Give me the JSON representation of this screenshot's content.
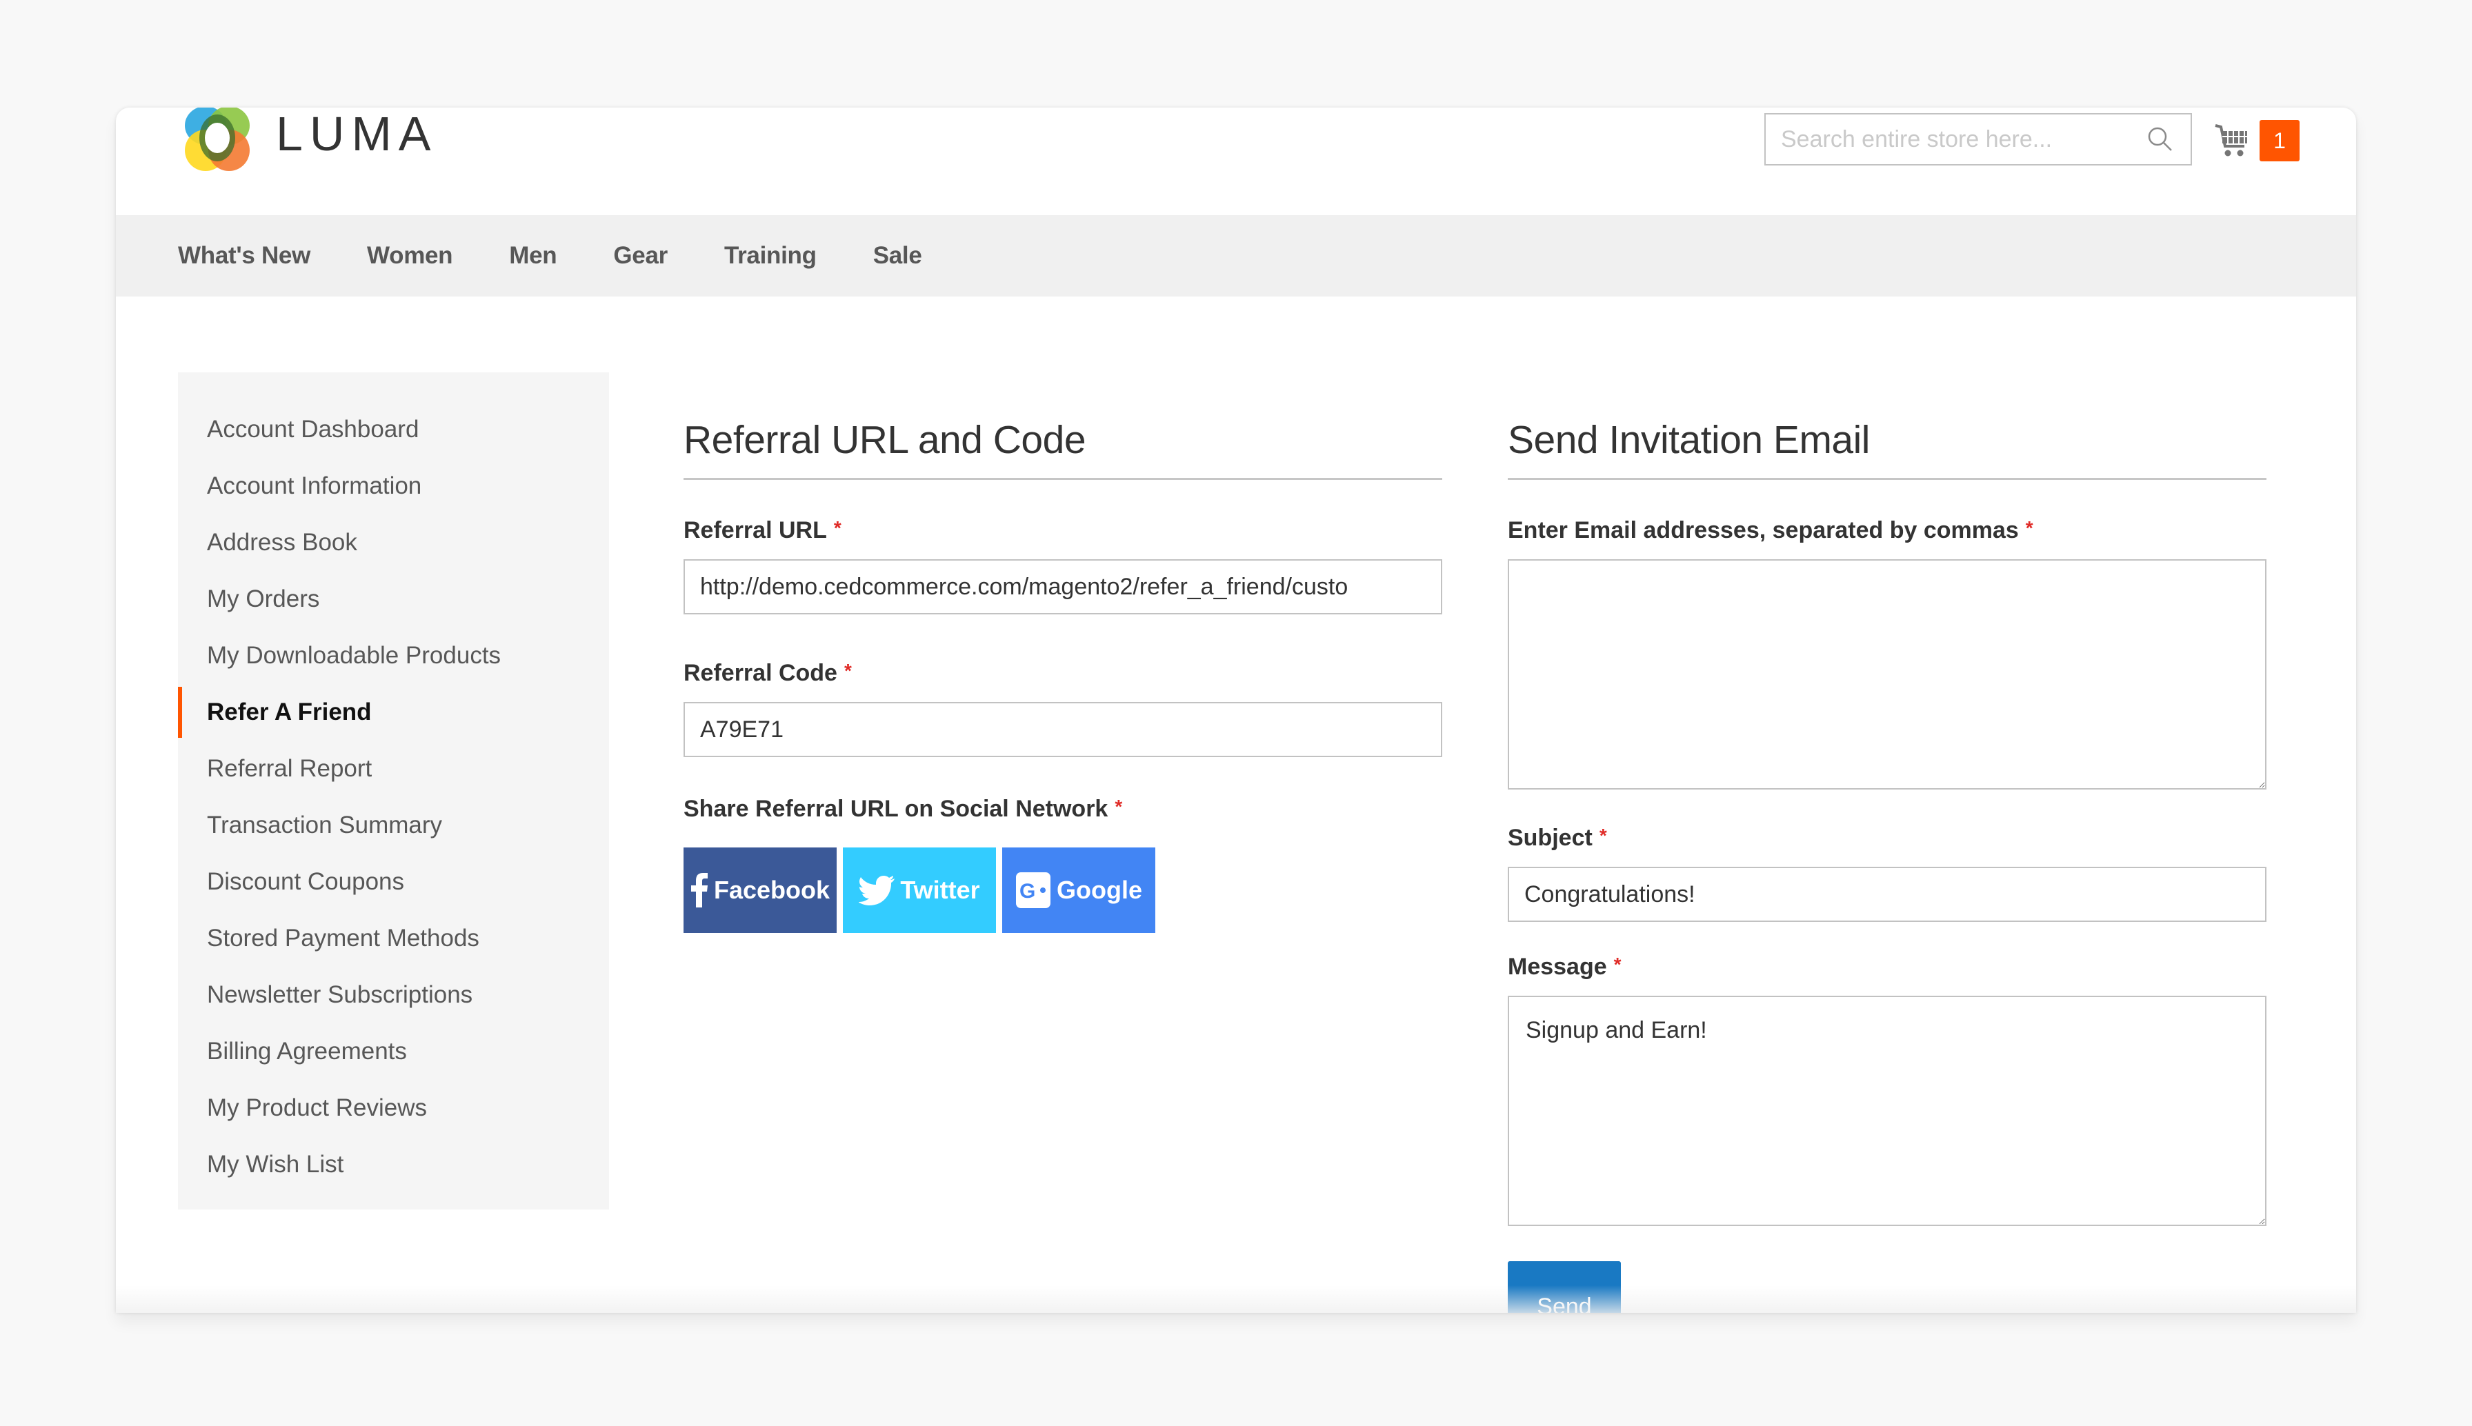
{
  "brand": {
    "name": "LUMA"
  },
  "header": {
    "search_placeholder": "Search entire store here...",
    "search_icon": "magnifier-icon",
    "cart_icon": "shopping-cart-icon",
    "cart_count": "1",
    "accent_color": "#ff5501"
  },
  "nav": {
    "items": [
      {
        "label": "What's New"
      },
      {
        "label": "Women"
      },
      {
        "label": "Men"
      },
      {
        "label": "Gear"
      },
      {
        "label": "Training"
      },
      {
        "label": "Sale"
      }
    ]
  },
  "sidebar": {
    "active_index": 5,
    "items": [
      {
        "label": "Account Dashboard"
      },
      {
        "label": "Account Information"
      },
      {
        "label": "Address Book"
      },
      {
        "label": "My Orders"
      },
      {
        "label": "My Downloadable Products"
      },
      {
        "label": "Refer A Friend"
      },
      {
        "label": "Referral Report"
      },
      {
        "label": "Transaction Summary"
      },
      {
        "label": "Discount Coupons"
      },
      {
        "label": "Stored Payment Methods"
      },
      {
        "label": "Newsletter Subscriptions"
      },
      {
        "label": "Billing Agreements"
      },
      {
        "label": "My Product Reviews"
      },
      {
        "label": "My Wish List"
      }
    ]
  },
  "referral": {
    "title": "Referral URL and Code",
    "url_label": "Referral URL",
    "url_value": "http://demo.cedcommerce.com/magento2/refer_a_friend/custo",
    "code_label": "Referral Code",
    "code_value": "A79E71",
    "share_label": "Share Referral URL on Social Network",
    "required_mark": "*",
    "social": [
      {
        "label": "Facebook",
        "icon": "facebook-icon",
        "color": "#3b5998"
      },
      {
        "label": "Twitter",
        "icon": "twitter-icon",
        "color": "#33ccff"
      },
      {
        "label": "Google",
        "icon": "google-plus-icon",
        "color": "#4285f4"
      }
    ]
  },
  "invite": {
    "title": "Send Invitation Email",
    "emails_label": "Enter Email addresses, separated by commas",
    "emails_value": "",
    "subject_label": "Subject",
    "subject_value": "Congratulations!",
    "message_label": "Message",
    "message_value": "Signup and Earn!",
    "required_mark": "*",
    "send_label": "Send",
    "send_color": "#1979c3"
  }
}
